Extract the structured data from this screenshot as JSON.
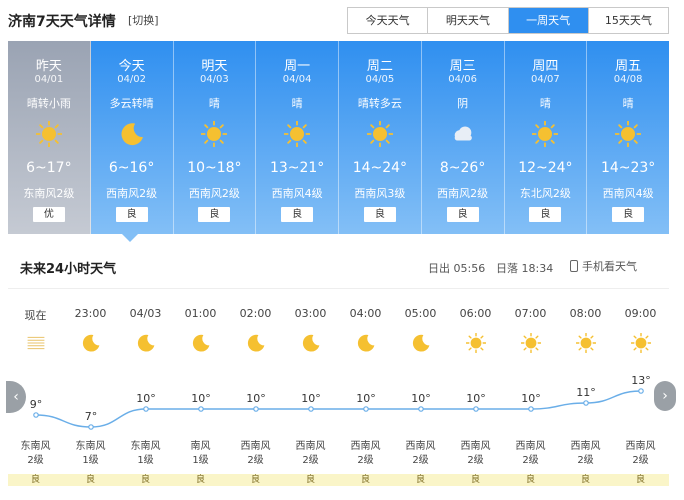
{
  "header": {
    "title": "济南7天天气详情",
    "switch_label": "[切换]",
    "tabs": [
      {
        "label": "今天天气",
        "active": false
      },
      {
        "label": "明天天气",
        "active": false
      },
      {
        "label": "一周天气",
        "active": true
      },
      {
        "label": "15天天气",
        "active": false
      }
    ]
  },
  "days": [
    {
      "name": "昨天",
      "date": "04/01",
      "desc": "晴转小雨",
      "icon": "sun-icon",
      "temp": "6~17°",
      "wind": "东南风2级",
      "aqi": "优",
      "past": true
    },
    {
      "name": "今天",
      "date": "04/02",
      "desc": "多云转晴",
      "icon": "moon-icon",
      "temp": "6~16°",
      "wind": "西南风2级",
      "aqi": "良",
      "past": false
    },
    {
      "name": "明天",
      "date": "04/03",
      "desc": "晴",
      "icon": "sun-icon",
      "temp": "10~18°",
      "wind": "西南风2级",
      "aqi": "良",
      "past": false
    },
    {
      "name": "周一",
      "date": "04/04",
      "desc": "晴",
      "icon": "sun-icon",
      "temp": "13~21°",
      "wind": "西南风4级",
      "aqi": "良",
      "past": false
    },
    {
      "name": "周二",
      "date": "04/05",
      "desc": "晴转多云",
      "icon": "sun-icon",
      "temp": "14~24°",
      "wind": "西南风3级",
      "aqi": "良",
      "past": false
    },
    {
      "name": "周三",
      "date": "04/06",
      "desc": "阴",
      "icon": "cloud-icon",
      "temp": "8~26°",
      "wind": "西南风2级",
      "aqi": "良",
      "past": false
    },
    {
      "name": "周四",
      "date": "04/07",
      "desc": "晴",
      "icon": "sun-icon",
      "temp": "12~24°",
      "wind": "东北风2级",
      "aqi": "良",
      "past": false
    },
    {
      "name": "周五",
      "date": "04/08",
      "desc": "晴",
      "icon": "sun-icon",
      "temp": "14~23°",
      "wind": "西南风4级",
      "aqi": "良",
      "past": false
    }
  ],
  "hourly_section": {
    "title": "未来24小时天气",
    "sunrise": "日出 05:56",
    "sunset": "日落 18:34",
    "mobile_label": "手机看天气"
  },
  "hourly": [
    {
      "time": "现在",
      "icon": "haze-icon",
      "temp": 9,
      "wind_dir": "东南风",
      "wind_level": "2级",
      "aqi": "良"
    },
    {
      "time": "23:00",
      "icon": "moon-icon",
      "temp": 7,
      "wind_dir": "东南风",
      "wind_level": "1级",
      "aqi": "良"
    },
    {
      "time": "04/03",
      "icon": "moon-icon",
      "temp": 10,
      "wind_dir": "东南风",
      "wind_level": "1级",
      "aqi": "良"
    },
    {
      "time": "01:00",
      "icon": "moon-icon",
      "temp": 10,
      "wind_dir": "南风",
      "wind_level": "1级",
      "aqi": "良"
    },
    {
      "time": "02:00",
      "icon": "moon-icon",
      "temp": 10,
      "wind_dir": "西南风",
      "wind_level": "2级",
      "aqi": "良"
    },
    {
      "time": "03:00",
      "icon": "moon-icon",
      "temp": 10,
      "wind_dir": "西南风",
      "wind_level": "2级",
      "aqi": "良"
    },
    {
      "time": "04:00",
      "icon": "moon-icon",
      "temp": 10,
      "wind_dir": "西南风",
      "wind_level": "2级",
      "aqi": "良"
    },
    {
      "time": "05:00",
      "icon": "moon-icon",
      "temp": 10,
      "wind_dir": "西南风",
      "wind_level": "2级",
      "aqi": "良"
    },
    {
      "time": "06:00",
      "icon": "sun-icon",
      "temp": 10,
      "wind_dir": "西南风",
      "wind_level": "2级",
      "aqi": "良"
    },
    {
      "time": "07:00",
      "icon": "sun-icon",
      "temp": 10,
      "wind_dir": "西南风",
      "wind_level": "2级",
      "aqi": "良"
    },
    {
      "time": "08:00",
      "icon": "sun-icon",
      "temp": 11,
      "wind_dir": "西南风",
      "wind_level": "2级",
      "aqi": "良"
    },
    {
      "time": "09:00",
      "icon": "sun-icon",
      "temp": 13,
      "wind_dir": "西南风",
      "wind_level": "2级",
      "aqi": "良"
    }
  ],
  "colors": {
    "accent": "#2f8ff0",
    "sun": "#f5c031",
    "line": "#6aaee8"
  },
  "nav": {
    "prev": "‹",
    "next": "›"
  }
}
